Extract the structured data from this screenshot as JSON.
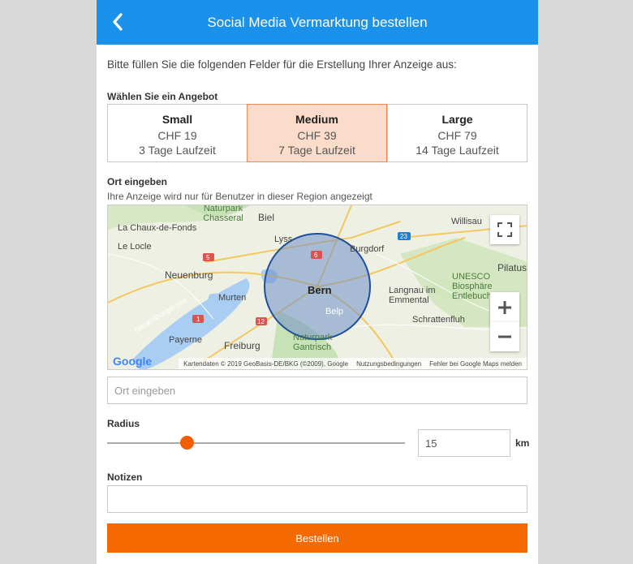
{
  "header": {
    "title": "Social Media Vermarktung bestellen"
  },
  "intro": "Bitte füllen Sie die folgenden Felder für die Erstellung Ihrer Anzeige aus:",
  "offer_label": "Wählen Sie ein Angebot",
  "offers": [
    {
      "name": "Small",
      "price": "CHF 19",
      "duration": "3 Tage Laufzeit",
      "selected": false
    },
    {
      "name": "Medium",
      "price": "CHF 39",
      "duration": "7 Tage Laufzeit",
      "selected": true
    },
    {
      "name": "Large",
      "price": "CHF 79",
      "duration": "14 Tage Laufzeit",
      "selected": false
    }
  ],
  "location": {
    "label": "Ort eingeben",
    "hint": "Ihre Anzeige wird nur für Benutzer in dieser Region angezeigt",
    "placeholder": "Ort eingeben"
  },
  "map": {
    "places": [
      "La Chaux-de-Fonds",
      "Naturpark Chasseral",
      "Biel",
      "Willisau",
      "Le Locle",
      "Lyss",
      "Burgdorf",
      "Neuenburg",
      "Pilatus",
      "UNESCO Biosphäre Entlebuch",
      "Neuenburgersee",
      "Murten",
      "Bern",
      "Langnau im Emmental",
      "Belp",
      "Schrattenfluh",
      "Payerne",
      "Freiburg",
      "Naturpark Gantrisch"
    ],
    "road_shields": [
      "5",
      "6",
      "23",
      "1",
      "12"
    ],
    "logo": "Google",
    "attribution": "Kartendaten © 2019 GeoBasis-DE/BKG (©2009), Google",
    "terms": "Nutzungsbedingungen",
    "report": "Fehler bei Google Maps melden",
    "colors": {
      "land": "#eef0e4",
      "park": "#c8e2b8",
      "water": "#a9cdf3",
      "radius_fill": "#6f90c6",
      "radius_stroke": "#1d4f9c"
    }
  },
  "radius": {
    "label": "Radius",
    "value": "15",
    "unit": "km",
    "slider_fraction": 0.26
  },
  "notes": {
    "label": "Notizen",
    "value": ""
  },
  "submit_label": "Bestellen",
  "colors": {
    "header": "#1a91ea",
    "accent": "#f56a00",
    "selected_bg": "#fbdcca"
  }
}
